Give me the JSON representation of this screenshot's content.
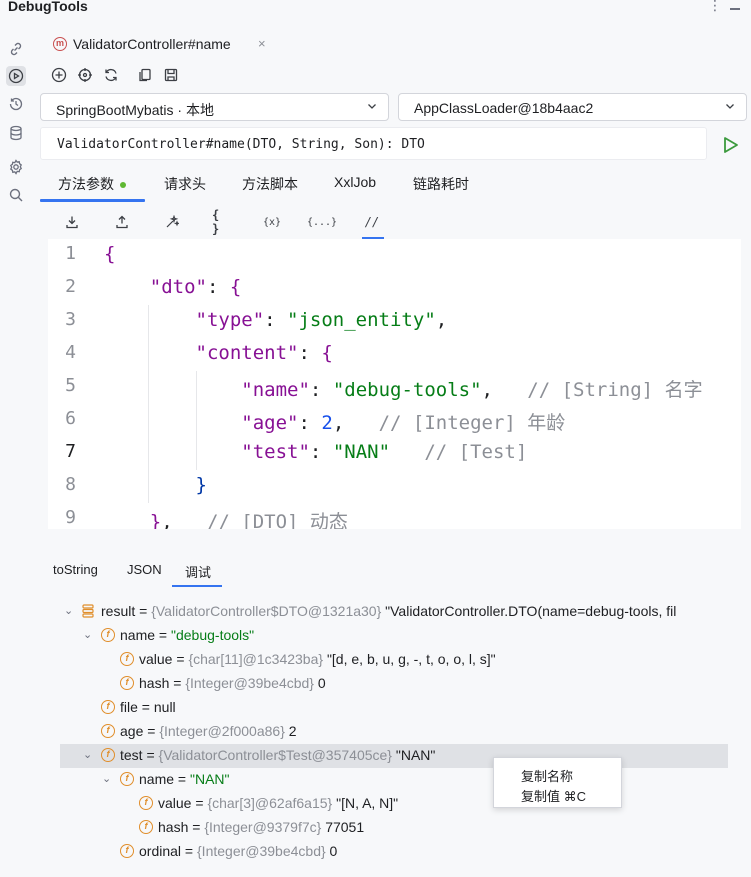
{
  "app": {
    "title": "DebugTools",
    "more_label": "⋮"
  },
  "tab": {
    "label": "ValidatorController#name",
    "badge": "m",
    "close": "×"
  },
  "selectors": {
    "project": "SpringBootMybatis · 本地",
    "classloader": "AppClassLoader@18b4aac2"
  },
  "signature": "ValidatorController#name(DTO, String, Son): DTO",
  "subtabs": [
    "方法参数",
    "请求头",
    "方法脚本",
    "XxlJob",
    "链路耗时"
  ],
  "editor_tools": [
    "{ }",
    "{x}",
    "{...}",
    "//"
  ],
  "editor": {
    "line_numbers": [
      "1",
      "2",
      "3",
      "4",
      "5",
      "6",
      "7",
      "8",
      "9"
    ],
    "lines": [
      {
        "indent": "",
        "parts": [
          {
            "t": "{",
            "c": "b1"
          }
        ]
      },
      {
        "indent": "    ",
        "parts": [
          {
            "t": "\"dto\"",
            "c": "k"
          },
          {
            "t": ": ",
            "c": "p"
          },
          {
            "t": "{",
            "c": "b1"
          }
        ]
      },
      {
        "indent": "        ",
        "parts": [
          {
            "t": "\"type\"",
            "c": "k"
          },
          {
            "t": ": ",
            "c": "p"
          },
          {
            "t": "\"json_entity\"",
            "c": "s"
          },
          {
            "t": ",",
            "c": "p"
          }
        ]
      },
      {
        "indent": "        ",
        "parts": [
          {
            "t": "\"content\"",
            "c": "k"
          },
          {
            "t": ": ",
            "c": "p"
          },
          {
            "t": "{",
            "c": "b1"
          }
        ]
      },
      {
        "indent": "            ",
        "parts": [
          {
            "t": "\"name\"",
            "c": "k"
          },
          {
            "t": ": ",
            "c": "p"
          },
          {
            "t": "\"debug-tools\"",
            "c": "s"
          },
          {
            "t": ",   ",
            "c": "p"
          },
          {
            "t": "// [String] 名字",
            "c": "c"
          }
        ]
      },
      {
        "indent": "            ",
        "parts": [
          {
            "t": "\"age\"",
            "c": "k"
          },
          {
            "t": ": ",
            "c": "p"
          },
          {
            "t": "2",
            "c": "n"
          },
          {
            "t": ",   ",
            "c": "p"
          },
          {
            "t": "// [Integer] 年龄",
            "c": "c"
          }
        ]
      },
      {
        "indent": "            ",
        "parts": [
          {
            "t": "\"test\"",
            "c": "k"
          },
          {
            "t": ": ",
            "c": "p"
          },
          {
            "t": "\"NAN\"",
            "c": "s"
          },
          {
            "t": "   ",
            "c": "p"
          },
          {
            "t": "// [Test]",
            "c": "c"
          }
        ]
      },
      {
        "indent": "        ",
        "parts": [
          {
            "t": "}",
            "c": "b2"
          }
        ]
      },
      {
        "indent": "    ",
        "parts": [
          {
            "t": "}",
            "c": "b1"
          },
          {
            "t": ",   ",
            "c": "p"
          },
          {
            "t": "// [DTO] 动态",
            "c": "c"
          }
        ]
      }
    ]
  },
  "bottom_tabs": [
    "toString",
    "JSON",
    "调试"
  ],
  "tree": [
    {
      "level": 0,
      "arrow": "⌄",
      "icon": "result",
      "name": "result",
      "eq": " = ",
      "type": "{ValidatorController$DTO@1321a30}",
      "value": " \"ValidatorController.DTO(name=debug-tools, fil",
      "vclass": "tkey"
    },
    {
      "level": 1,
      "arrow": "⌄",
      "icon": "f",
      "name": "name",
      "eq": " =  ",
      "type": "",
      "value": "\"debug-tools\"",
      "vclass": "tgreen"
    },
    {
      "level": 2,
      "arrow": "",
      "icon": "f",
      "name": "value",
      "eq": " = ",
      "type": "{char[11]@1c3423ba}",
      "value": " \"[d, e, b, u, g, -, t, o, o, l, s]\"",
      "vclass": "tkey"
    },
    {
      "level": 2,
      "arrow": "",
      "icon": "f",
      "name": "hash",
      "eq": " = ",
      "type": "{Integer@39be4cbd}",
      "value": " 0",
      "vclass": "tkey"
    },
    {
      "level": 1,
      "arrow": "",
      "icon": "f",
      "name": "file",
      "eq": " =  ",
      "type": "",
      "value": "null",
      "vclass": "tkey"
    },
    {
      "level": 1,
      "arrow": "",
      "icon": "f",
      "name": "age",
      "eq": " = ",
      "type": "{Integer@2f000a86}",
      "value": " 2",
      "vclass": "tkey"
    },
    {
      "level": 1,
      "arrow": "⌄",
      "icon": "f",
      "name": "test",
      "eq": " = ",
      "type": "{ValidatorController$Test@357405ce}",
      "value": " \"NAN\"",
      "vclass": "tkey",
      "selected": true
    },
    {
      "level": 2,
      "arrow": "⌄",
      "icon": "f",
      "name": "name",
      "eq": " =  ",
      "type": "",
      "value": "\"NAN\"",
      "vclass": "tgreen"
    },
    {
      "level": 3,
      "arrow": "",
      "icon": "f",
      "name": "value",
      "eq": " = ",
      "type": "{char[3]@62af6a15}",
      "value": " \"[N, A, N]\"",
      "vclass": "tkey"
    },
    {
      "level": 3,
      "arrow": "",
      "icon": "f",
      "name": "hash",
      "eq": " = ",
      "type": "{Integer@9379f7c}",
      "value": " 77051",
      "vclass": "tkey"
    },
    {
      "level": 2,
      "arrow": "",
      "icon": "f",
      "name": "ordinal",
      "eq": " = ",
      "type": "{Integer@39be4cbd}",
      "value": " 0",
      "vclass": "tkey"
    }
  ],
  "context_menu": [
    "复制名称",
    "复制值  ⌘C"
  ]
}
